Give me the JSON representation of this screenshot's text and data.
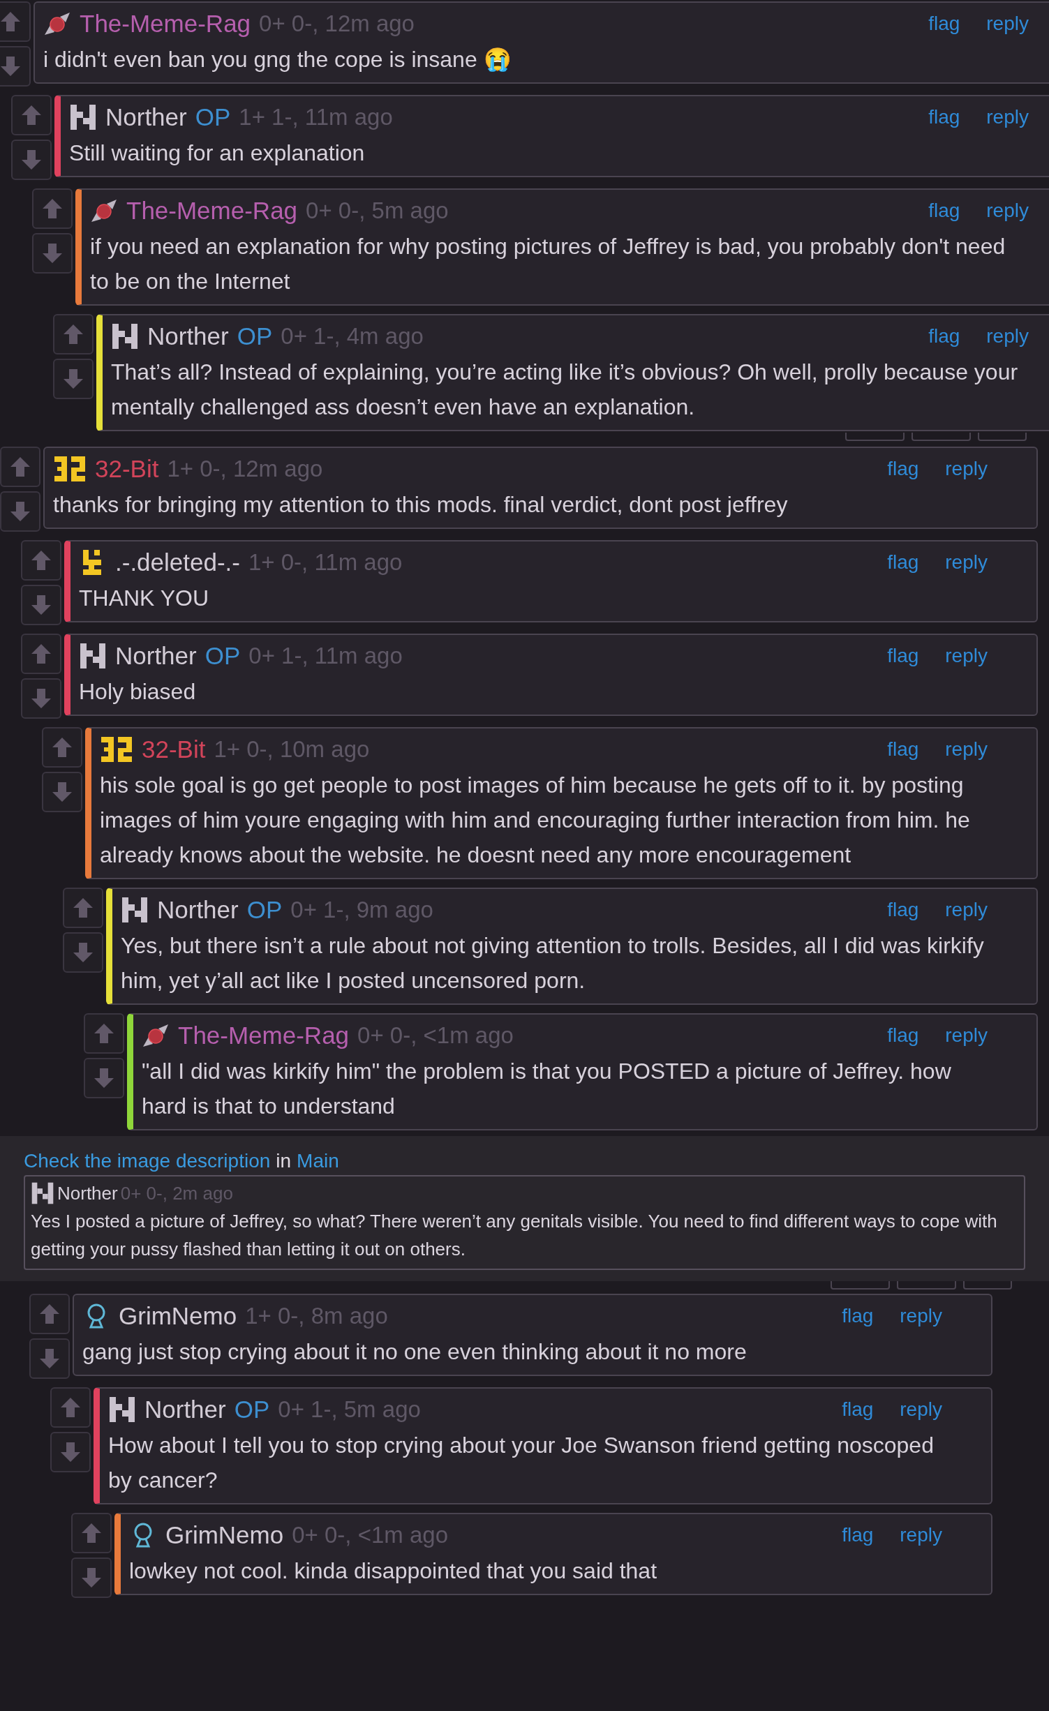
{
  "sections": [
    {
      "kind": "thread",
      "comments": [
        {
          "author": "The-Meme-Rag",
          "avatar": {
            "kind": "candy"
          },
          "color": "#b65fae",
          "op": false,
          "meta": "0+ 0-, 12m ago",
          "actions": [
            "flag",
            "reply"
          ],
          "body": "i didn't even ban you gng the cope is insane 😭",
          "children": [
            {
              "author": "Norther",
              "avatar": {
                "kind": "n-block"
              },
              "color": "#d3ccd6",
              "op": true,
              "op_label": "OP",
              "meta": "1+ 1-, 11m ago",
              "actions": [
                "flag",
                "reply"
              ],
              "body": "Still waiting for an explanation",
              "children": [
                {
                  "author": "The-Meme-Rag",
                  "avatar": {
                    "kind": "candy"
                  },
                  "color": "#b65fae",
                  "op": false,
                  "meta": "0+ 0-, 5m ago",
                  "actions": [
                    "flag",
                    "reply"
                  ],
                  "body": "if you need an explanation for why posting pictures of Jeffrey is bad, you probably don't need to be on the Internet",
                  "children": [
                    {
                      "author": "Norther",
                      "avatar": {
                        "kind": "n-block"
                      },
                      "color": "#d3ccd6",
                      "op": true,
                      "op_label": "OP",
                      "meta": "0+ 1-, 4m ago",
                      "actions": [
                        "flag",
                        "reply"
                      ],
                      "body": "That’s all? Instead of explaining, you’re acting like it’s obvious? Oh well, prolly because your mentally challenged ass doesn’t even have an explanation."
                    }
                  ]
                }
              ]
            }
          ]
        }
      ]
    },
    {
      "kind": "thread",
      "comments": [
        {
          "author": "32-Bit",
          "avatar": {
            "kind": "blocks"
          },
          "color": "#d2445a",
          "op": false,
          "meta": "1+ 0-, 12m ago",
          "actions": [
            "flag",
            "reply"
          ],
          "body": "thanks for bringing my attention to this mods. final verdict, dont post jeffrey",
          "children": [
            {
              "author": ".-.deleted-.-",
              "avatar": {
                "kind": "pixel-figure"
              },
              "color": "#d3ccd6",
              "op": false,
              "meta": "1+ 0-, 11m ago",
              "actions": [
                "flag",
                "reply"
              ],
              "body": "THANK YOU"
            },
            {
              "author": "Norther",
              "avatar": {
                "kind": "n-block"
              },
              "color": "#d3ccd6",
              "op": true,
              "op_label": "OP",
              "meta": "0+ 1-, 11m ago",
              "actions": [
                "flag",
                "reply"
              ],
              "body": "Holy biased",
              "children": [
                {
                  "author": "32-Bit",
                  "avatar": {
                    "kind": "blocks"
                  },
                  "color": "#d2445a",
                  "op": false,
                  "meta": "1+ 0-, 10m ago",
                  "actions": [
                    "flag",
                    "reply"
                  ],
                  "body": "his sole goal is go get people to post images of him because he gets off to it. by posting images of him youre engaging with him and encouraging further interaction from him. he already knows about the website. he doesnt need any more encouragement",
                  "children": [
                    {
                      "author": "Norther",
                      "avatar": {
                        "kind": "n-block"
                      },
                      "color": "#d3ccd6",
                      "op": true,
                      "op_label": "OP",
                      "meta": "0+ 1-, 9m ago",
                      "actions": [
                        "flag",
                        "reply"
                      ],
                      "body": "Yes, but there isn’t a rule about not giving attention to trolls. Besides, all I did was kirkify him, yet y’all act like I posted uncensored porn.",
                      "children": [
                        {
                          "author": "The-Meme-Rag",
                          "avatar": {
                            "kind": "candy"
                          },
                          "color": "#b65fae",
                          "op": false,
                          "meta": "0+ 0-, <1m ago",
                          "actions": [
                            "flag",
                            "reply"
                          ],
                          "body": "\"all I did was kirkify him\" the problem is that you POSTED a picture of Jeffrey. how hard is that to understand"
                        }
                      ]
                    }
                  ]
                }
              ]
            }
          ]
        }
      ]
    },
    {
      "kind": "quote",
      "link": "Check the image description",
      "joiner": "in",
      "place": "Main",
      "author": "Norther",
      "avatar": {
        "kind": "n-block"
      },
      "meta": "0+ 0-, 2m ago",
      "body": "Yes I posted a picture of Jeffrey, so what? There weren’t any genitals visible. You need to find different ways to cope with getting your pussy flashed than letting it out on others."
    },
    {
      "kind": "thread",
      "comments": [
        {
          "author": "GrimNemo",
          "avatar": {
            "kind": "person"
          },
          "color": "#d3ccd6",
          "op": false,
          "meta": "1+ 0-, 8m ago",
          "actions": [
            "flag",
            "reply"
          ],
          "body": "gang just stop crying about it no one even thinking about it no more",
          "children": [
            {
              "author": "Norther",
              "avatar": {
                "kind": "n-block"
              },
              "color": "#d3ccd6",
              "op": true,
              "op_label": "OP",
              "meta": "0+ 1-, 5m ago",
              "actions": [
                "flag",
                "reply"
              ],
              "body": "How about I tell you to stop crying about your Joe Swanson friend getting noscoped by cancer?",
              "children": [
                {
                  "author": "GrimNemo",
                  "avatar": {
                    "kind": "person"
                  },
                  "color": "#d3ccd6",
                  "op": false,
                  "meta": "0+ 0-, <1m ago",
                  "actions": [
                    "flag",
                    "reply"
                  ],
                  "body": "lowkey not cool. kinda disappointed that you said that"
                }
              ]
            }
          ]
        }
      ]
    }
  ]
}
